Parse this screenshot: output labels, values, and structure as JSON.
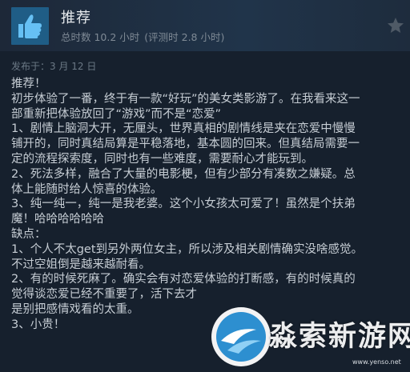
{
  "header": {
    "title": "推荐",
    "hours_total": "总时数 10.2 小时",
    "hours_review": "(评测时 2.8 小时)"
  },
  "posted": "发布于：3 月 12 日",
  "review_lines": [
    "推荐！",
    "初步体验了一番，终于有一款“好玩”的美女类影游了。在我看来这一",
    "部重新把体验放回了“游戏”而不是“恋爱”",
    "1、剧情上脑洞大开，无厘头，世界真相的剧情线是夹在恋爱中慢慢",
    "铺开的，同时真结局算是平稳落地，基本圆的回来。但真结局需要一",
    "定的流程探索度，同时也有一些难度，需要耐心才能玩到。",
    "2、死法多样，融合了大量的电影梗，但有少部分有凑数之嫌疑。总",
    "体上能随时给人惊喜的体验。",
    "3、纯一纯一，纯一是我老婆。这个小女孩太可爱了！虽然是个扶弟",
    "魔！哈哈哈哈哈哈",
    "缺点：",
    "1、个人不太get到另外两位女主，所以涉及相关剧情确实没啥感觉。",
    "不过空姐倒是越来越耐看。",
    "2、有的时候死麻了。确实会有对恋爱体验的打断感，有的时候真的",
    "觉得谈恋爱已经不重要了，活下去才",
    "是别把感情戏看的太重。",
    "3、小贵！"
  ],
  "watermark": {
    "text": "淼索新游网",
    "url": "www.yenso.net"
  },
  "icons": {
    "thumb": "thumbs-up-icon",
    "award": "award-star-icon"
  },
  "colors": {
    "thumb_bg": "#1f5d86",
    "thumb_fg": "#66c0f4"
  }
}
